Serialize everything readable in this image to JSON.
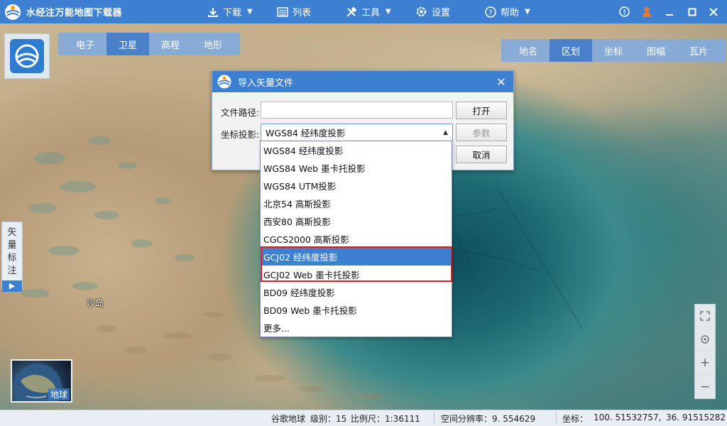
{
  "app": {
    "title": "水经注万能地图下载器"
  },
  "menu": {
    "download": "下载",
    "list": "列表",
    "tools": "工具",
    "settings": "设置",
    "help": "帮助"
  },
  "map_tabs": [
    "电子",
    "卫星",
    "高程",
    "地形"
  ],
  "map_tabs_active": "卫星",
  "right_tabs": [
    "地名",
    "区划",
    "坐标",
    "图幅",
    "瓦片"
  ],
  "right_tabs_active": "区划",
  "side_tab": {
    "chars": [
      "矢",
      "量",
      "标",
      "注"
    ]
  },
  "map_label": "沙岛",
  "globe_thumb_label": "地球",
  "zoom": {
    "plus": "+",
    "minus": "−"
  },
  "statusbar": {
    "source": "谷歌地球",
    "level": "级别：15",
    "scale": "比例尺：1:36111",
    "resolution": "空间分辨率：9. 554629",
    "coord_label": "坐标：",
    "lon": "100. 51532757,",
    "lat": "36. 91515282"
  },
  "dialog": {
    "title": "导入矢量文件",
    "path_label": "文件路径:",
    "path_value": "",
    "proj_label": "坐标投影:",
    "proj_value": "WGS84 经纬度投影",
    "open_btn": "打开",
    "params_btn": "参数",
    "cancel_btn": "取消",
    "close": "✕"
  },
  "dropdown": {
    "options": [
      "WGS84 经纬度投影",
      "WGS84 Web 墨卡托投影",
      "WGS84 UTM投影",
      "北京54 高斯投影",
      "西安80 高斯投影",
      "CGCS2000 高斯投影",
      "GCJ02 经纬度投影",
      "GCJ02 Web 墨卡托投影",
      "BD09 经纬度投影",
      "BD09 Web 墨卡托投影",
      "更多..."
    ],
    "selected_index": 6
  },
  "colors": {
    "brand": "#3d7fd1",
    "highlight": "#e02020"
  }
}
